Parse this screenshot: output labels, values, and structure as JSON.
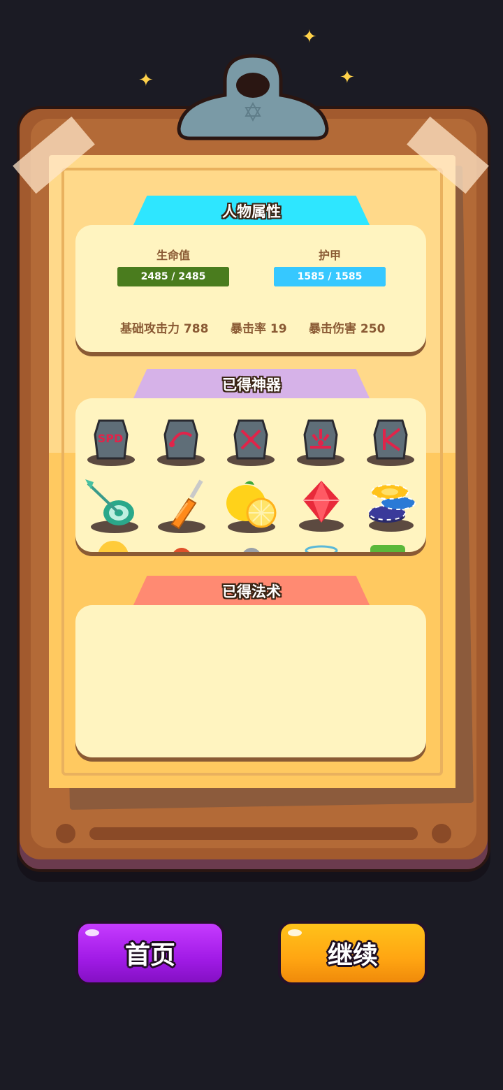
{
  "colors": {
    "background": "#1b1b24",
    "board": "#a25a2e",
    "paper": "#ffd98a",
    "health_bar": "#4a7c1e",
    "armor_bar": "#36c8ff",
    "tab_stats": "#2ee6ff",
    "tab_artifacts": "#d6b2e8",
    "tab_spells": "#ff8a72",
    "home_button": "#a11be6",
    "continue_button": "#ff9e12"
  },
  "sections": {
    "stats_title": "人物属性",
    "artifacts_title": "已得神器",
    "spells_title": "已得法术"
  },
  "stats": {
    "hp_label": "生命值",
    "hp_value": "2485 / 2485",
    "hp_fraction": 1,
    "armor_label": "护甲",
    "armor_value": "1585 / 1585",
    "armor_fraction": 1,
    "attack": "基础攻击力 788",
    "crit_rate": "暴击率 19",
    "crit_damage": "暴击伤害 250"
  },
  "artifacts": [
    {
      "icon": "speed-rune-stone-icon",
      "text": "SPD"
    },
    {
      "icon": "arc-rune-stone-icon"
    },
    {
      "icon": "cross-arrows-rune-stone-icon"
    },
    {
      "icon": "burst-rune-stone-icon"
    },
    {
      "icon": "k-rune-stone-icon"
    },
    {
      "icon": "dart-target-icon"
    },
    {
      "icon": "screwdriver-icon"
    },
    {
      "icon": "lemon-icon"
    },
    {
      "icon": "red-gem-icon"
    },
    {
      "icon": "poker-chips-icon"
    }
  ],
  "spells": [],
  "buttons": {
    "home": "首页",
    "continue": "继续"
  }
}
